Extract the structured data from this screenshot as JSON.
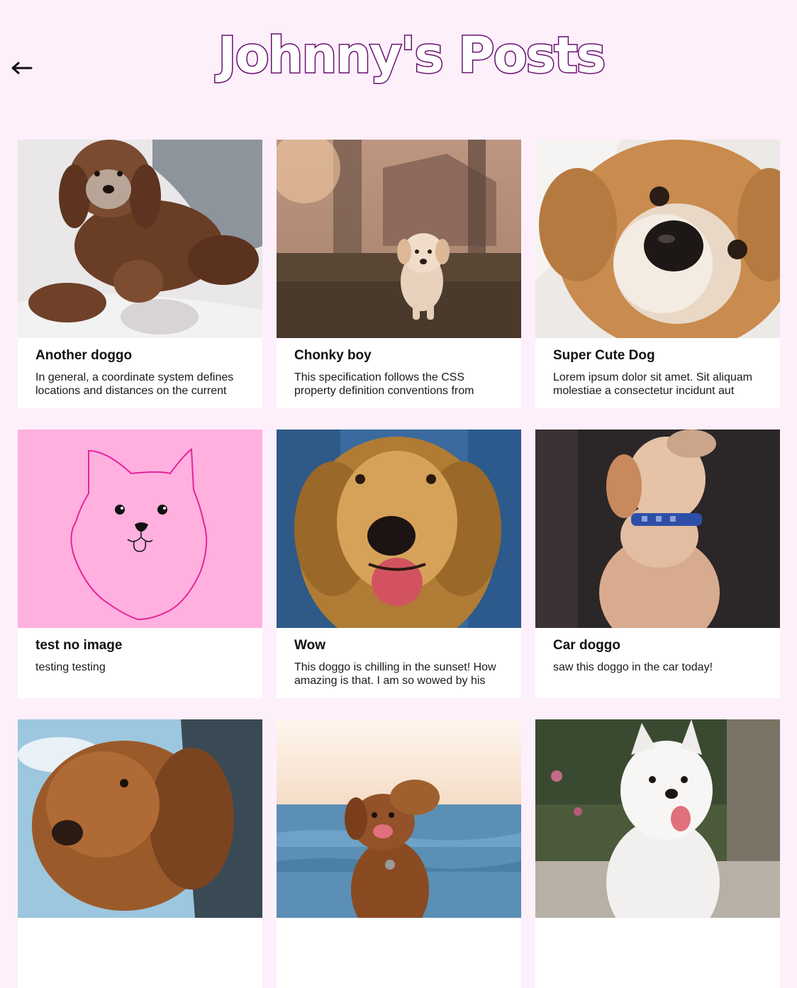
{
  "header": {
    "title": "Johnny's Posts",
    "back_icon": "arrow-left-icon"
  },
  "colors": {
    "background": "#fdf0fb",
    "title_outline": "#6a1070",
    "card_background": "#ffffff"
  },
  "posts": [
    {
      "title": "Another doggo",
      "description": "In general, a coordinate system defines locations and distances on the current",
      "image": "curly-brown-dog-on-bed-photo"
    },
    {
      "title": "Chonky boy",
      "description": "This specification follows the CSS property definition conventions from",
      "image": "puppy-running-on-grass-photo"
    },
    {
      "title": "Super Cute Dog",
      "description": "Lorem ipsum dolor sit amet. Sit aliquam molestiae a consectetur incidunt aut",
      "image": "dog-face-closeup-photo"
    },
    {
      "title": "test no image",
      "description": "testing testing",
      "image": "dog-doodle-drawing"
    },
    {
      "title": "Wow",
      "description": "This doggo is chilling in the sunset! How amazing is that. I am so wowed by his",
      "image": "golden-retriever-photo"
    },
    {
      "title": "Car doggo",
      "description": "saw this doggo in the car today!",
      "image": "labrador-puppy-with-collar-photo"
    },
    {
      "title": "",
      "description": "",
      "image": "spaniel-in-car-window-photo"
    },
    {
      "title": "",
      "description": "",
      "image": "dog-at-beach-photo"
    },
    {
      "title": "",
      "description": "",
      "image": "white-samoyed-photo"
    }
  ]
}
